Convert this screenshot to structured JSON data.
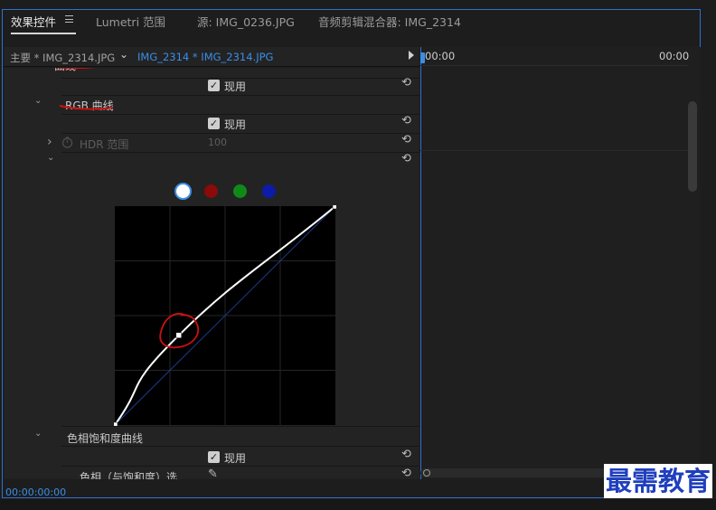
{
  "tabs": [
    {
      "label": "效果控件",
      "active": true
    },
    {
      "label": "Lumetri 范围"
    },
    {
      "label": "源: IMG_0236.JPG"
    },
    {
      "label": "音频剪辑混合器: IMG_2314"
    }
  ],
  "subheader": {
    "master": "主要 * IMG_2314.JPG",
    "dropdown_glyph": "⌄",
    "clip": "IMG_2314 * IMG_2314.JPG"
  },
  "rows": {
    "curves_section": "曲线",
    "enabled_1": "现用",
    "rgb_curves": "RGB 曲线",
    "enabled_2": "现用",
    "hdr_range_label": "HDR 范围",
    "hdr_range_value": "100",
    "hue_sat_curves": "色相饱和度曲线",
    "enabled_3": "现用",
    "hue_vs_sat": "色相（与饱和度）选..."
  },
  "glyphs": {
    "reset": "⟲",
    "chevron_down": "⌄",
    "chevron_right": "›",
    "check": "✓",
    "eyedropper": "✎"
  },
  "channels": [
    {
      "name": "white",
      "color": "#ffffff"
    },
    {
      "name": "red",
      "color": "#8b0a0a"
    },
    {
      "name": "green",
      "color": "#0f8a18"
    },
    {
      "name": "blue",
      "color": "#0c1ca8"
    }
  ],
  "curve": {
    "points": [
      [
        0,
        0
      ],
      [
        0.29,
        0.41
      ],
      [
        1,
        1
      ]
    ]
  },
  "timeline": {
    "start_tc": "00:00",
    "end_tc": "00:00"
  },
  "footer": {
    "timecode": "00:00:00:00"
  },
  "watermark": "最需教育",
  "colors": {
    "accent": "#3a8ee6",
    "border": "#2f6fd0",
    "annotation": "#d01010"
  }
}
